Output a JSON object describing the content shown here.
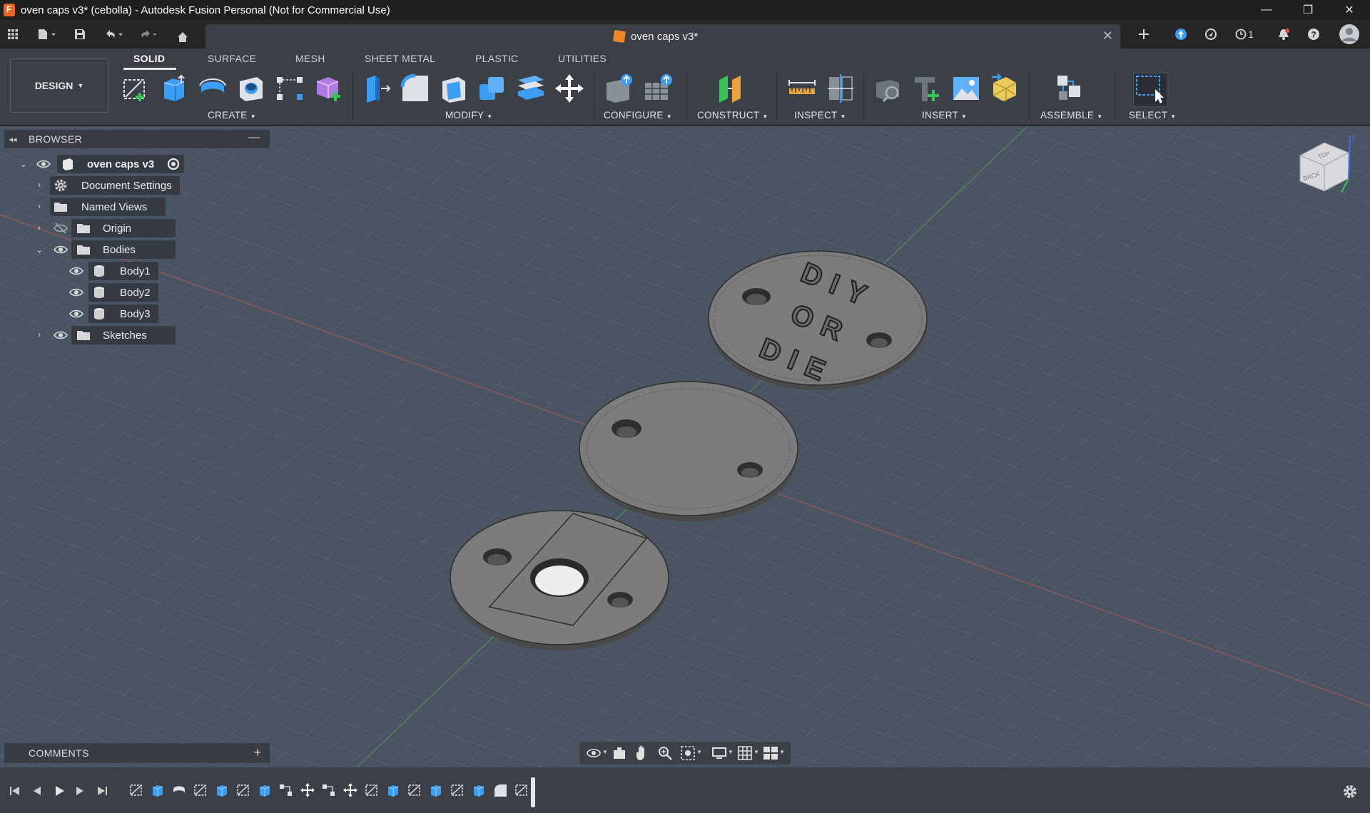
{
  "window": {
    "title": "oven caps v3* (cebolla) - Autodesk Fusion Personal (Not for Commercial Use)",
    "controls": [
      "—",
      "❐",
      "✕"
    ]
  },
  "tabbar": {
    "document_tab": "oven caps v3*",
    "notification_count": "1"
  },
  "ribbon": {
    "workspace": "DESIGN",
    "tabs": [
      {
        "label": "SOLID",
        "active": true
      },
      {
        "label": "SURFACE",
        "active": false
      },
      {
        "label": "MESH",
        "active": false
      },
      {
        "label": "SHEET METAL",
        "active": false
      },
      {
        "label": "PLASTIC",
        "active": false
      },
      {
        "label": "UTILITIES",
        "active": false
      }
    ],
    "groups": [
      {
        "label": "CREATE"
      },
      {
        "label": "MODIFY"
      },
      {
        "label": "CONFIGURE"
      },
      {
        "label": "CONSTRUCT"
      },
      {
        "label": "INSPECT"
      },
      {
        "label": "INSERT"
      },
      {
        "label": "ASSEMBLE"
      },
      {
        "label": "SELECT"
      }
    ]
  },
  "browser": {
    "title": "BROWSER",
    "root": "oven caps v3",
    "items": [
      {
        "label": "Document Settings",
        "icon": "gear-icon"
      },
      {
        "label": "Named Views",
        "icon": "folder-icon"
      },
      {
        "label": "Origin",
        "icon": "folder-icon"
      },
      {
        "label": "Bodies",
        "icon": "folder-icon"
      },
      {
        "label": "Body1",
        "icon": "body-icon"
      },
      {
        "label": "Body2",
        "icon": "body-icon"
      },
      {
        "label": "Body3",
        "icon": "body-icon"
      },
      {
        "label": "Sketches",
        "icon": "folder-icon"
      }
    ]
  },
  "comments": {
    "title": "COMMENTS"
  },
  "model": {
    "engraving_lines": [
      "DIY",
      "OR",
      "DIE"
    ],
    "body_color": "#7c7c7c"
  },
  "viewcube": {
    "faces": [
      "TOP",
      "BACK"
    ]
  },
  "colors": {
    "accent_blue": "#3d9df3",
    "viewport_bg": "#4a5361",
    "ribbon_bg": "#3b3f46"
  }
}
